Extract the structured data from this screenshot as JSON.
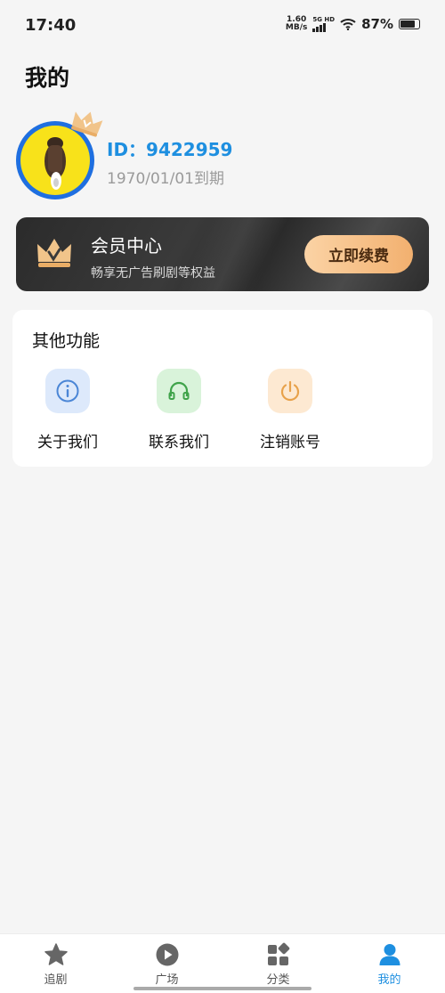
{
  "status": {
    "time": "17:40",
    "net_speed_value": "1.60",
    "net_speed_unit": "MB/s",
    "network_type": "5G HD",
    "battery": "87%"
  },
  "page": {
    "title": "我的"
  },
  "profile": {
    "id": "ID：9422959",
    "expire": "1970/01/01到期"
  },
  "vip": {
    "title": "会员中心",
    "subtitle": "畅享无广告刷剧等权益",
    "button": "立即续费",
    "button_colors": [
      "#fbd3a5",
      "#f2b06f"
    ]
  },
  "functions": {
    "title": "其他功能",
    "items": [
      {
        "label": "关于我们",
        "icon": "info-icon",
        "bg": "#dde9fb",
        "color": "#4b86d6"
      },
      {
        "label": "联系我们",
        "icon": "headset-icon",
        "bg": "#d9f3da",
        "color": "#3fa34a"
      },
      {
        "label": "注销账号",
        "icon": "power-icon",
        "bg": "#fde9d2",
        "color": "#e8a24b"
      }
    ]
  },
  "tabs": [
    {
      "label": "追剧",
      "icon": "star-icon",
      "active": false
    },
    {
      "label": "广场",
      "icon": "play-icon",
      "active": false
    },
    {
      "label": "分类",
      "icon": "category-icon",
      "active": false
    },
    {
      "label": "我的",
      "icon": "user-icon",
      "active": true
    }
  ],
  "colors": {
    "accent": "#1e8fe0",
    "background": "#f5f5f5"
  }
}
